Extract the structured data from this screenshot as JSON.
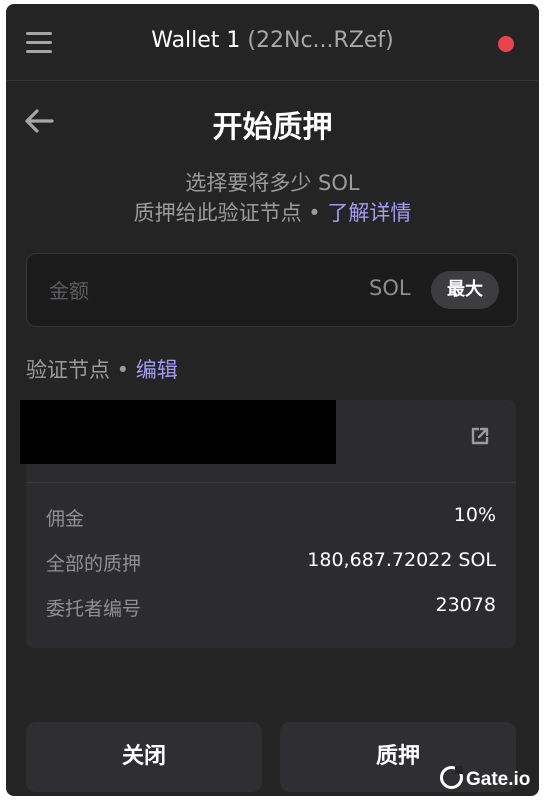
{
  "header": {
    "wallet_name": "Wallet 1",
    "wallet_address": "(22Nc...RZef)",
    "status_color": "#e8434e"
  },
  "page": {
    "title": "开始质押",
    "desc_line1": "选择要将多少 SOL",
    "desc_line2": "质押给此验证节点 •",
    "learn_more": "了解详情"
  },
  "amount": {
    "placeholder": "金额",
    "unit": "SOL",
    "max_label": "最大"
  },
  "validator": {
    "heading": "验证节点 •",
    "edit_label": "编辑",
    "rows": [
      {
        "key": "佣金",
        "value": "10%"
      },
      {
        "key": "全部的质押",
        "value": "180,687.72022 SOL"
      },
      {
        "key": "委托者编号",
        "value": "23078"
      }
    ]
  },
  "buttons": {
    "close": "关闭",
    "stake": "质押"
  },
  "watermark": {
    "text": "Gate.io"
  },
  "colors": {
    "accent": "#a39cf2",
    "background": "#242425"
  }
}
